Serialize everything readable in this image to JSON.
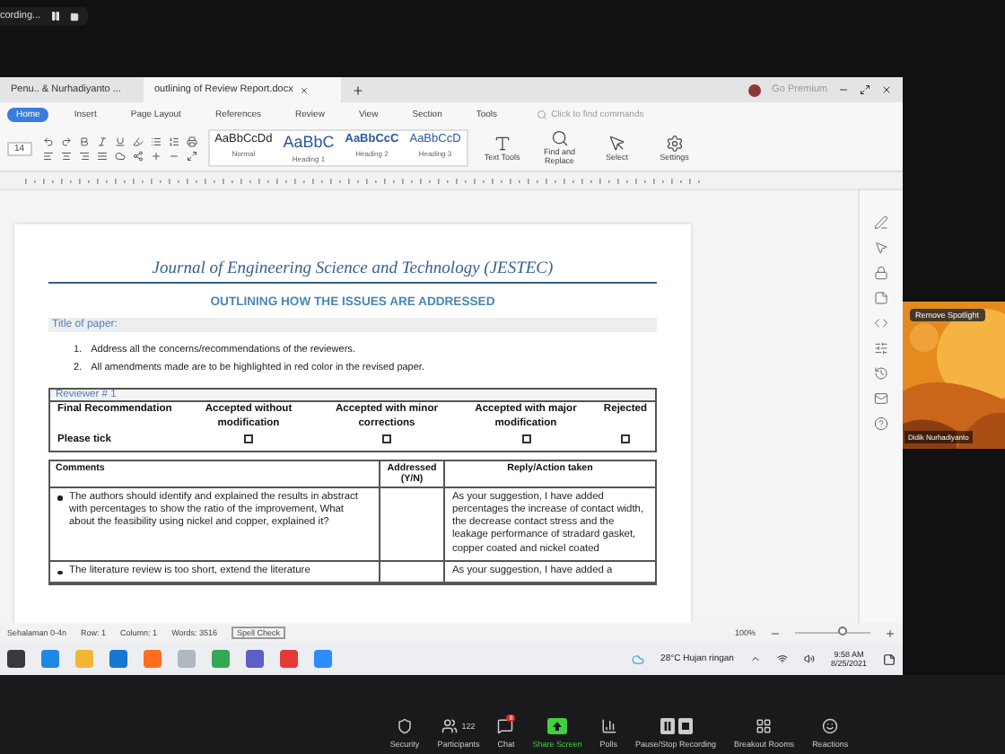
{
  "recording": {
    "label": "cording..."
  },
  "tabs": [
    {
      "label": "Penu.. & Nurhadiyanto ...",
      "selected": false
    },
    {
      "label": "outlining of Review Report.docx",
      "selected": true
    }
  ],
  "account": {
    "label": "Go Premium"
  },
  "menu": [
    {
      "label": "Home",
      "selected": true
    },
    {
      "label": "Insert",
      "selected": false
    },
    {
      "label": "Page Layout",
      "selected": false
    },
    {
      "label": "References",
      "selected": false
    },
    {
      "label": "Review",
      "selected": false
    },
    {
      "label": "View",
      "selected": false
    },
    {
      "label": "Section",
      "selected": false
    },
    {
      "label": "Tools",
      "selected": false
    }
  ],
  "command_search": {
    "placeholder": "Click to find commands"
  },
  "font_size": "14",
  "styles": [
    {
      "sample": "AaBbCcDd",
      "name": "Normal",
      "kind": "normal"
    },
    {
      "sample": "AaBbC",
      "name": "Heading 1",
      "kind": "h1"
    },
    {
      "sample": "AaBbCcC",
      "name": "Heading 2",
      "kind": "h2"
    },
    {
      "sample": "AaBbCcD",
      "name": "Heading 3",
      "kind": "h3"
    }
  ],
  "tools": [
    {
      "label": "Text Tools",
      "kind": "text"
    },
    {
      "label": "Find and Replace",
      "kind": "find"
    },
    {
      "label": "Select",
      "kind": "select"
    },
    {
      "label": "Settings",
      "kind": "settings"
    }
  ],
  "document": {
    "journal": "Journal of Engineering Science and Technology (JESTEC)",
    "heading": "OUTLINING HOW THE ISSUES ARE ADDRESSED",
    "title_label": "Title of paper:",
    "instructions": [
      {
        "marker": "1.",
        "text": "Address all the concerns/recommendations of the reviewers."
      },
      {
        "marker": "2.",
        "text": "All amendments made are to be highlighted in red color in the revised paper."
      }
    ],
    "reviewer": "Reviewer # 1",
    "recommendation_label": "Final Recommendation",
    "tick_label": "Please tick",
    "options": [
      {
        "label": "Accepted without modification",
        "checked": false
      },
      {
        "label": "Accepted with minor corrections",
        "checked": false
      },
      {
        "label": "Accepted with major modification",
        "checked": false
      },
      {
        "label": "Rejected",
        "checked": false
      }
    ],
    "columns": [
      "Comments",
      "Addressed (Y/N)",
      "Reply/Action taken"
    ],
    "rows": [
      {
        "comment": "The authors should identify and explained the results in abstract with percentages to show the ratio of the improvement, What about the feasibility using nickel and copper, explained it?",
        "addressed": "",
        "reply": "As your suggestion, I have added percentages the increase of contact width, the decrease contact stress and the leakage performance of stradard gasket, copper coated and nickel coated"
      },
      {
        "comment": "The literature review is too short, extend the literature",
        "addressed": "",
        "reply": "As your suggestion, I have added a"
      }
    ]
  },
  "status_bar": {
    "items": [
      "Sehalaman 0-4n",
      "Row: 1",
      "Column: 1",
      "Words: 3516"
    ],
    "spell_check": "Spell Check",
    "zoom": "100%",
    "level": 0.62
  },
  "taskbar": {
    "weather": "28°C  Hujan ringan",
    "time": "9:58 AM",
    "date": "8/25/2021"
  },
  "video": {
    "action": "Remove Spotlight",
    "name": "Didik Nurhadiyanto"
  },
  "meeting_toolbar": [
    {
      "label": "Security",
      "kind": "security"
    },
    {
      "label": "Participants",
      "kind": "participants",
      "count": "122"
    },
    {
      "label": "Chat",
      "kind": "chat",
      "badge": "8"
    },
    {
      "label": "Share Screen",
      "kind": "share"
    },
    {
      "label": "Polls",
      "kind": "polls"
    },
    {
      "label": "Pause/Stop Recording",
      "kind": "recording"
    },
    {
      "label": "Breakout Rooms",
      "kind": "breakout"
    },
    {
      "label": "Reactions",
      "kind": "reactions"
    }
  ]
}
